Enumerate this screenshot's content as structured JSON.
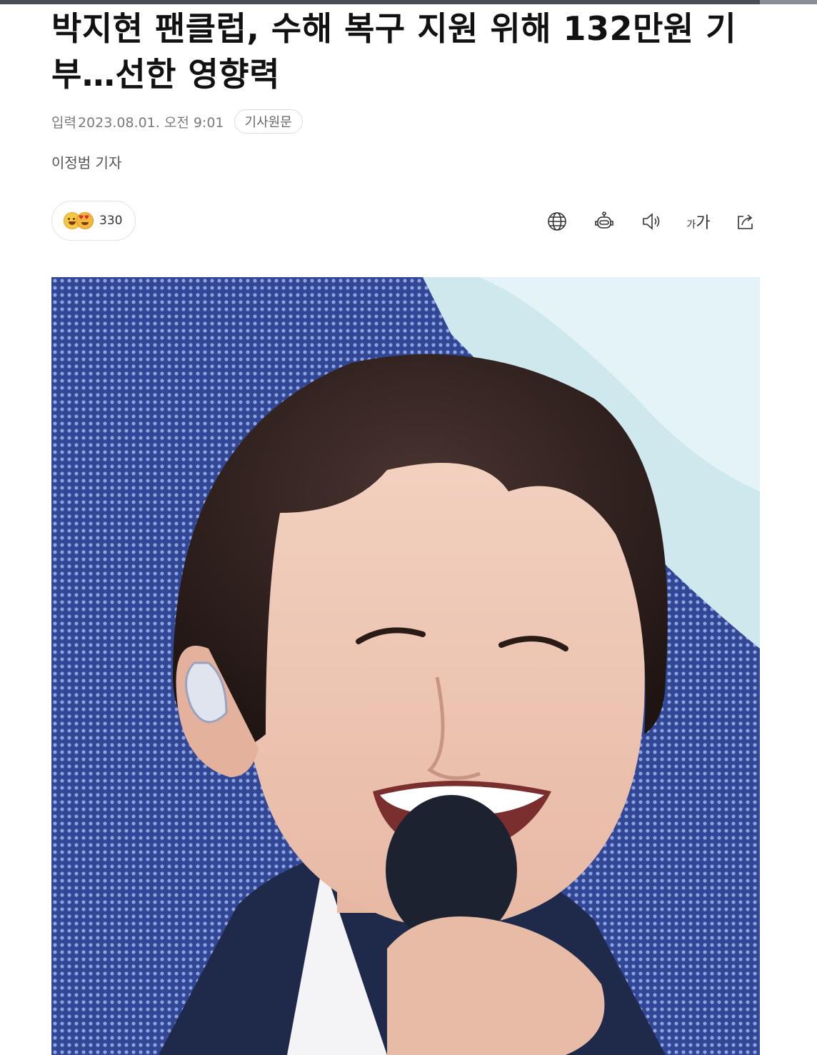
{
  "article": {
    "headline": "박지현 팬클럽, 수해 복구 지원 위해 132만원 기부…선한 영향력",
    "meta": {
      "label": "입력",
      "datetime": "2023.08.01. 오전 9:01",
      "original_button": "기사원문"
    },
    "reporter": "이정범 기자",
    "reactions": {
      "count": "330",
      "emoji_icons": [
        "laughing-face-icon",
        "heart-eyes-face-icon"
      ]
    },
    "toolbar": {
      "items": [
        {
          "name": "globe-icon"
        },
        {
          "name": "robot-summary-icon"
        },
        {
          "name": "speaker-icon"
        },
        {
          "name": "font-size-icon",
          "small": "가",
          "large": "가"
        },
        {
          "name": "share-icon"
        }
      ]
    }
  },
  "colors": {
    "text_primary": "#111111",
    "text_meta": "#7a7a7a",
    "border": "#dcdcdc",
    "photo_backdrop": "#2d3f86"
  }
}
